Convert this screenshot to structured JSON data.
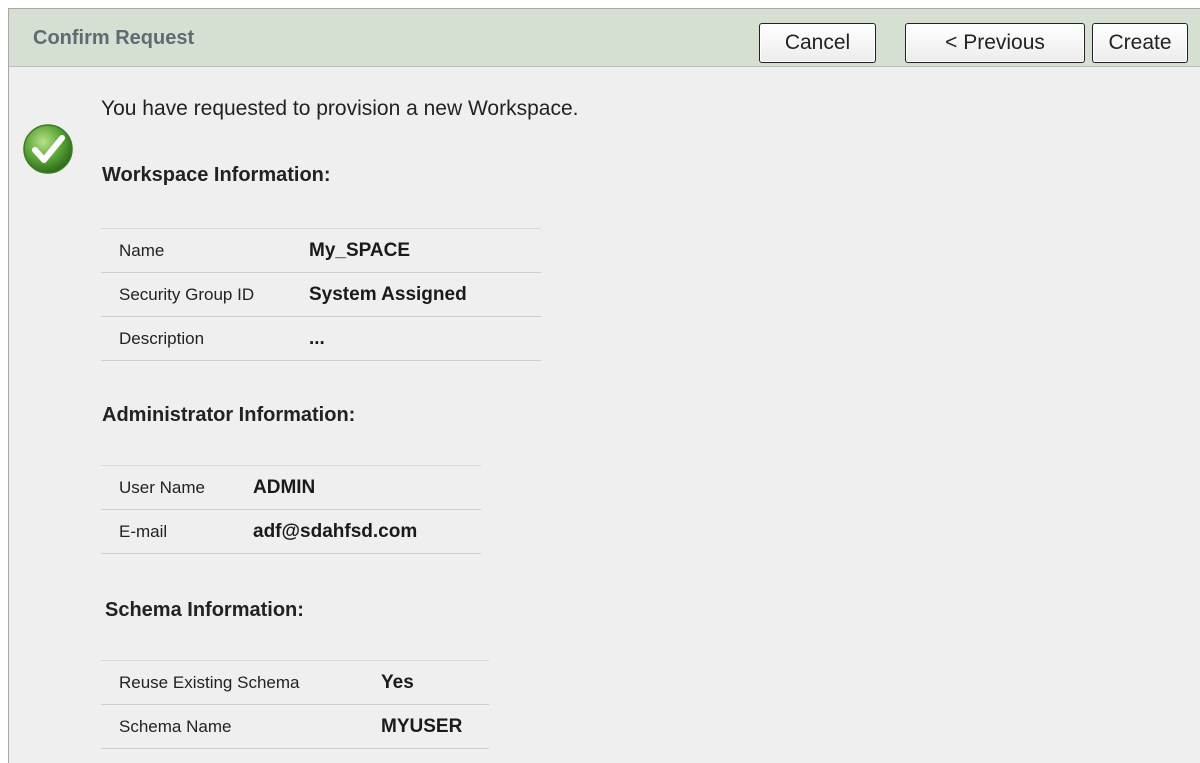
{
  "header": {
    "title": "Confirm Request",
    "buttons": {
      "cancel": "Cancel",
      "previous": "< Previous",
      "create": "Create"
    }
  },
  "message": "You have requested to provision a new Workspace.",
  "icons": {
    "status": "checkmark-icon"
  },
  "colors": {
    "header_bg": "#d6e0d2",
    "title": "#5d6b73",
    "success": "#4e9a2a"
  },
  "workspace": {
    "title": "Workspace Information:",
    "rows": [
      {
        "label": "Name",
        "value": "My_SPACE"
      },
      {
        "label": "Security Group ID",
        "value": "System Assigned"
      },
      {
        "label": "Description",
        "value": "..."
      }
    ]
  },
  "administrator": {
    "title": "Administrator Information:",
    "rows": [
      {
        "label": "User Name",
        "value": "ADMIN"
      },
      {
        "label": "E-mail",
        "value": "adf@sdahfsd.com"
      }
    ]
  },
  "schema": {
    "title": "Schema Information:",
    "rows": [
      {
        "label": "Reuse Existing Schema",
        "value": "Yes"
      },
      {
        "label": "Schema Name",
        "value": "MYUSER"
      }
    ]
  }
}
